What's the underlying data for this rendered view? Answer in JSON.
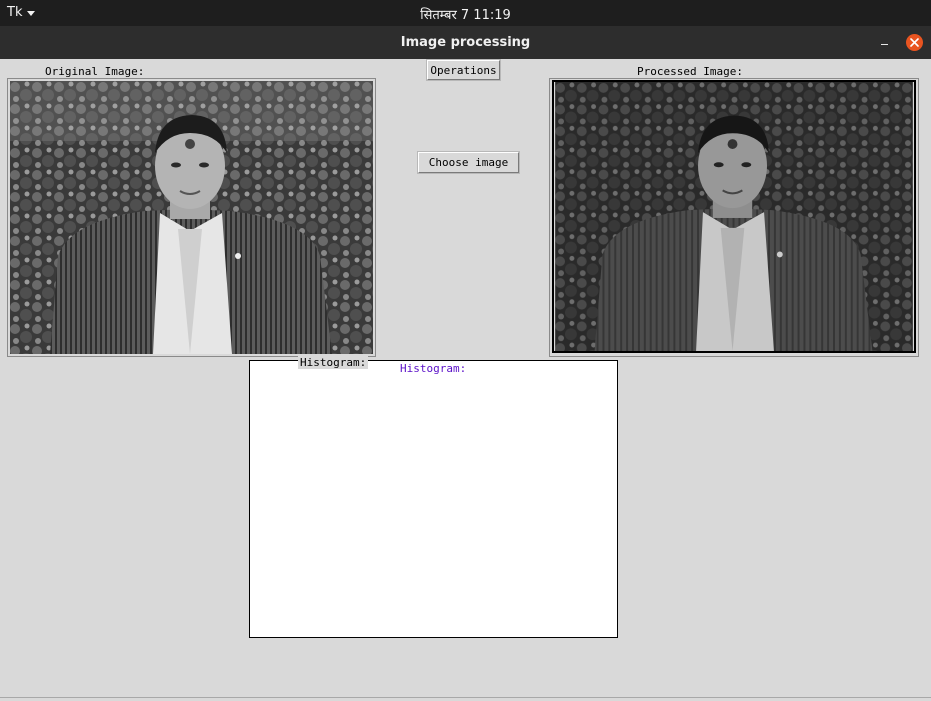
{
  "topbar": {
    "app_name": "Tk",
    "clock": "सितम्बर 7  11:19"
  },
  "window": {
    "title": "Image processing"
  },
  "labels": {
    "original": "Original Image:",
    "processed": "Processed Image:",
    "histogram_frame": "Histogram:",
    "histogram_canvas": "Histogram:"
  },
  "buttons": {
    "operations": "Operations",
    "choose_image": "Choose image"
  },
  "colors": {
    "accent_close": "#e95420",
    "histogram_label": "#5a10c8"
  },
  "icons": [
    "chevron-down-icon",
    "minimize-icon",
    "close-icon"
  ]
}
